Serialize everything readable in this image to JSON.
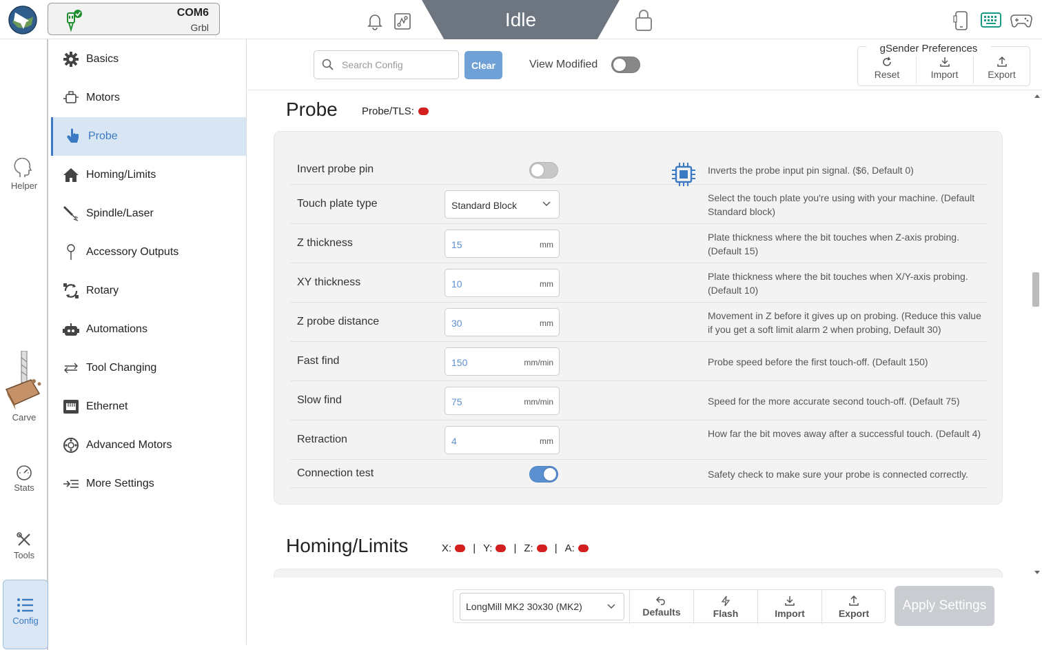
{
  "app": {
    "connection": {
      "port": "COM6",
      "firmware": "Grbl"
    },
    "status": "Idle",
    "status_color": "#6d7581",
    "accent": "#3b79c2"
  },
  "leftnav": {
    "helper": "Helper",
    "carve": "Carve",
    "stats": "Stats",
    "tools": "Tools",
    "config": "Config"
  },
  "categories": [
    {
      "label": "Basics",
      "icon": "gear-icon"
    },
    {
      "label": "Motors",
      "icon": "motor-icon"
    },
    {
      "label": "Probe",
      "icon": "touch-icon",
      "active": true
    },
    {
      "label": "Homing/Limits",
      "icon": "home-icon"
    },
    {
      "label": "Spindle/Laser",
      "icon": "spindle-icon"
    },
    {
      "label": "Accessory Outputs",
      "icon": "pin-icon"
    },
    {
      "label": "Rotary",
      "icon": "rotary-icon"
    },
    {
      "label": "Automations",
      "icon": "robot-icon"
    },
    {
      "label": "Tool Changing",
      "icon": "swap-icon"
    },
    {
      "label": "Ethernet",
      "icon": "ethernet-icon"
    },
    {
      "label": "Advanced Motors",
      "icon": "advanced-motor-icon"
    },
    {
      "label": "More Settings",
      "icon": "more-settings-icon"
    }
  ],
  "toolbar": {
    "search_placeholder": "Search Config",
    "clear": "Clear",
    "view_modified": "View Modified",
    "prefs_title": "gSender Preferences",
    "reset": "Reset",
    "import": "Import",
    "export": "Export"
  },
  "probe": {
    "title": "Probe",
    "status_label": "Probe/TLS:",
    "rows": [
      {
        "label": "Invert probe pin",
        "type": "toggle",
        "on": false,
        "desc": "Inverts the probe input pin signal. ($6, Default 0)"
      },
      {
        "label": "Touch plate type",
        "type": "select",
        "value": "Standard Block",
        "desc": "Select the touch plate you're using with your machine. (Default Standard block)"
      },
      {
        "label": "Z thickness",
        "type": "input",
        "value": "15",
        "unit": "mm",
        "desc": "Plate thickness where the bit touches when Z-axis probing. (Default 15)"
      },
      {
        "label": "XY thickness",
        "type": "input",
        "value": "10",
        "unit": "mm",
        "desc": "Plate thickness where the bit touches when X/Y-axis probing. (Default 10)"
      },
      {
        "label": "Z probe distance",
        "type": "input",
        "value": "30",
        "unit": "mm",
        "desc": "Movement in Z before it gives up on probing. (Reduce this value if you get a soft limit alarm 2 when probing, Default 30)"
      },
      {
        "label": "Fast find",
        "type": "input",
        "value": "150",
        "unit": "mm/min",
        "desc": "Probe speed before the first touch-off. (Default 150)"
      },
      {
        "label": "Slow find",
        "type": "input",
        "value": "75",
        "unit": "mm/min",
        "desc": "Speed for the more accurate second touch-off. (Default 75)"
      },
      {
        "label": "Retraction",
        "type": "input",
        "value": "4",
        "unit": "mm",
        "desc": "How far the bit moves away after a successful touch. (Default 4)"
      },
      {
        "label": "Connection test",
        "type": "toggle",
        "on": true,
        "desc": "Safety check to make sure your probe is connected correctly."
      }
    ]
  },
  "homing": {
    "title": "Homing/Limits",
    "axes": [
      "X:",
      "Y:",
      "Z:",
      "A:"
    ],
    "sep": "|"
  },
  "bottom": {
    "machine": "LongMill MK2 30x30 (MK2)",
    "defaults": "Defaults",
    "flash": "Flash",
    "import": "Import",
    "export": "Export",
    "apply": "Apply Settings"
  }
}
